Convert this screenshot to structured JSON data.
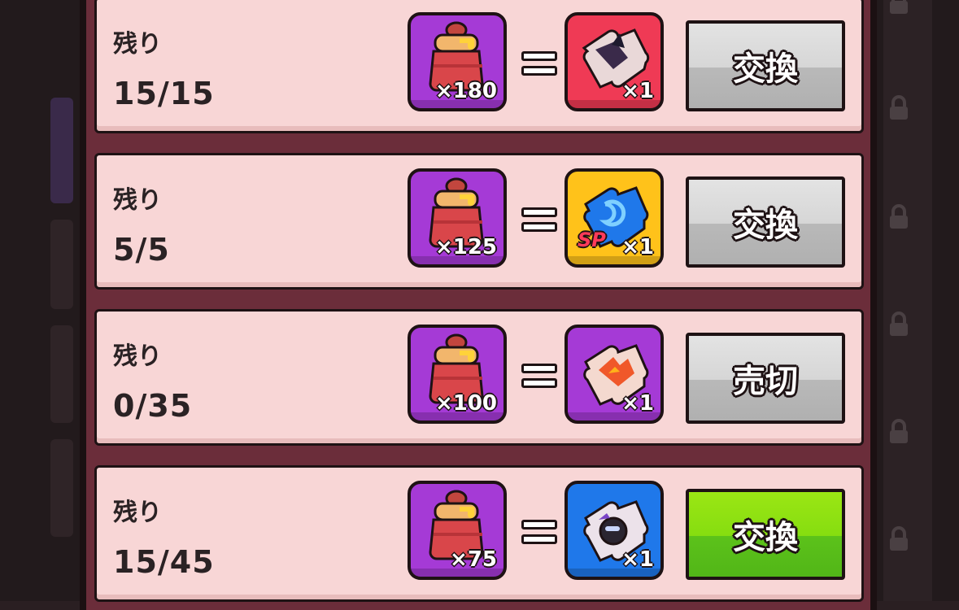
{
  "rows": [
    {
      "remain_label": "残り",
      "remain_count": "15/15",
      "cost_qty": "×180",
      "reward_qty": "×1",
      "reward_color": "#ef3a55",
      "reward_icon": "dark-puzzle-piece-icon",
      "button_label": "交換",
      "button_state": "gray"
    },
    {
      "remain_label": "残り",
      "remain_count": "5/5",
      "cost_qty": "×125",
      "reward_qty": "×1",
      "reward_badge": "SP",
      "reward_color": "#ffc21a",
      "reward_icon": "blue-puzzle-piece-icon",
      "button_label": "交換",
      "button_state": "gray"
    },
    {
      "remain_label": "残り",
      "remain_count": "0/35",
      "cost_qty": "×100",
      "reward_qty": "×1",
      "reward_color": "#a53ad6",
      "reward_icon": "orange-puzzle-piece-icon",
      "button_label": "売切",
      "button_state": "gray"
    },
    {
      "remain_label": "残り",
      "remain_count": "15/45",
      "cost_qty": "×75",
      "reward_qty": "×1",
      "reward_color": "#1f78ea",
      "reward_icon": "gray-puzzle-piece-icon",
      "button_label": "交換",
      "button_state": "green"
    }
  ],
  "cost_icon": "honey-pot-icon",
  "colors": {
    "row_bg": "#f8d6d6",
    "frame": "#6b2d3a",
    "button_gray": "#d6d6d6",
    "button_green": "#86dd10"
  }
}
